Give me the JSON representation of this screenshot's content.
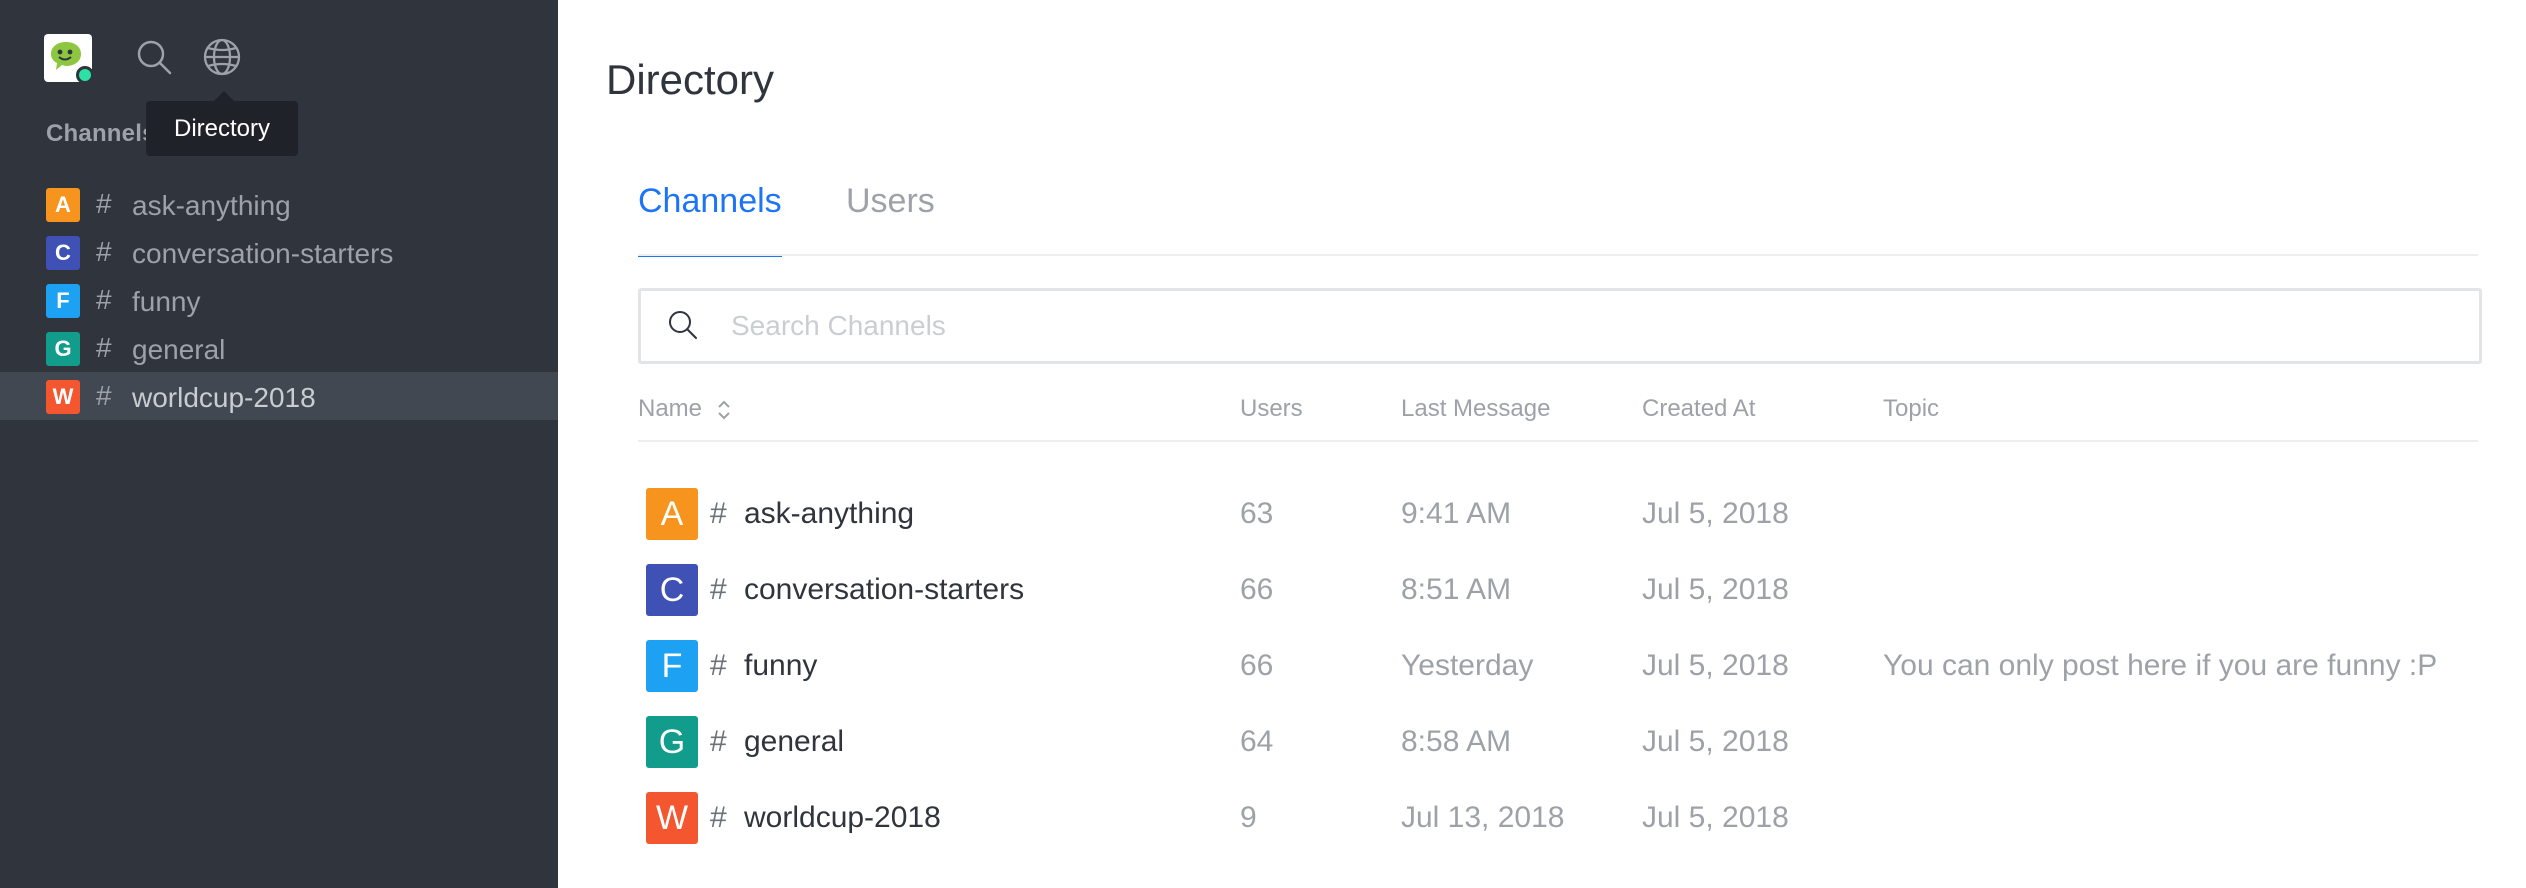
{
  "sidebar": {
    "section_label": "Channels",
    "tooltip": "Directory",
    "items": [
      {
        "letter": "A",
        "label": "ask-anything",
        "color": "#f7941d",
        "active": false
      },
      {
        "letter": "C",
        "label": "conversation-starters",
        "color": "#3f51b5",
        "active": false
      },
      {
        "letter": "F",
        "label": "funny",
        "color": "#1da1f2",
        "active": false
      },
      {
        "letter": "G",
        "label": "general",
        "color": "#129c8c",
        "active": false
      },
      {
        "letter": "W",
        "label": "worldcup-2018",
        "color": "#f4572f",
        "active": true
      }
    ]
  },
  "main": {
    "title": "Directory",
    "tabs": [
      {
        "label": "Channels",
        "active": true
      },
      {
        "label": "Users",
        "active": false
      }
    ],
    "search": {
      "placeholder": "Search Channels",
      "value": ""
    },
    "columns": {
      "name": "Name",
      "users": "Users",
      "last_message": "Last Message",
      "created_at": "Created At",
      "topic": "Topic"
    },
    "rows": [
      {
        "letter": "A",
        "name": "ask-anything",
        "color": "#f7941d",
        "users": "63",
        "last_message": "9:41 AM",
        "created_at": "Jul 5, 2018",
        "topic": ""
      },
      {
        "letter": "C",
        "name": "conversation-starters",
        "color": "#3f51b5",
        "users": "66",
        "last_message": "8:51 AM",
        "created_at": "Jul 5, 2018",
        "topic": ""
      },
      {
        "letter": "F",
        "name": "funny",
        "color": "#1da1f2",
        "users": "66",
        "last_message": "Yesterday",
        "created_at": "Jul 5, 2018",
        "topic": "You can only post here if you are funny :P"
      },
      {
        "letter": "G",
        "name": "general",
        "color": "#129c8c",
        "users": "64",
        "last_message": "8:58 AM",
        "created_at": "Jul 5, 2018",
        "topic": ""
      },
      {
        "letter": "W",
        "name": "worldcup-2018",
        "color": "#f4572f",
        "users": "9",
        "last_message": "Jul 13, 2018",
        "created_at": "Jul 5, 2018",
        "topic": ""
      }
    ]
  },
  "icons": {
    "logo": "rocket-chat-logo-icon",
    "search": "search-icon",
    "directory": "globe-icon",
    "sort": "sort-icon",
    "hash": "hash-icon"
  }
}
